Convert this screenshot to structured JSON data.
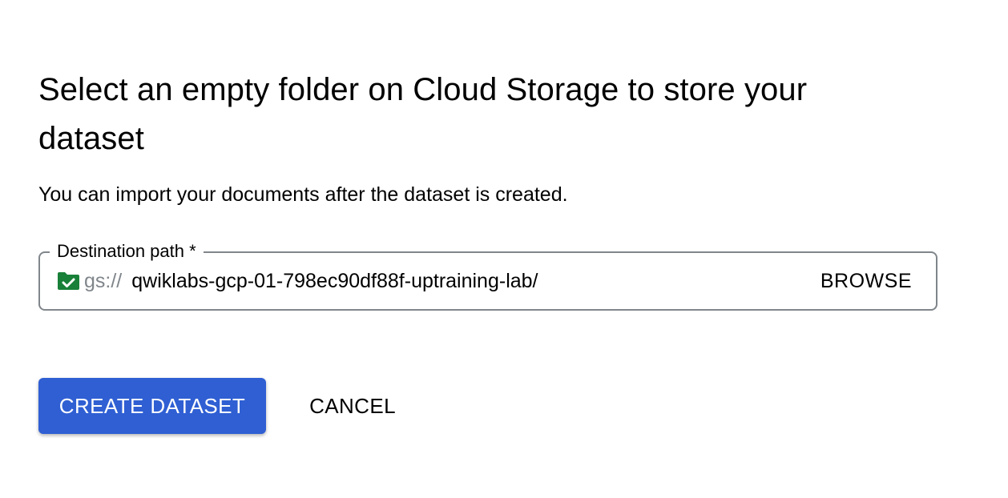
{
  "dialog": {
    "title": "Select an empty folder on Cloud Storage to store your dataset",
    "subtitle": "You can import your documents after the dataset is created."
  },
  "destination": {
    "label": "Destination path *",
    "prefix": "gs://",
    "value": "qwiklabs-gcp-01-798ec90df88f-uptraining-lab/",
    "browse_label": "BROWSE",
    "icon": "folder-check-icon",
    "icon_color": "#188038"
  },
  "actions": {
    "create_label": "CREATE DATASET",
    "cancel_label": "CANCEL",
    "primary_color": "#2f5fd3"
  }
}
